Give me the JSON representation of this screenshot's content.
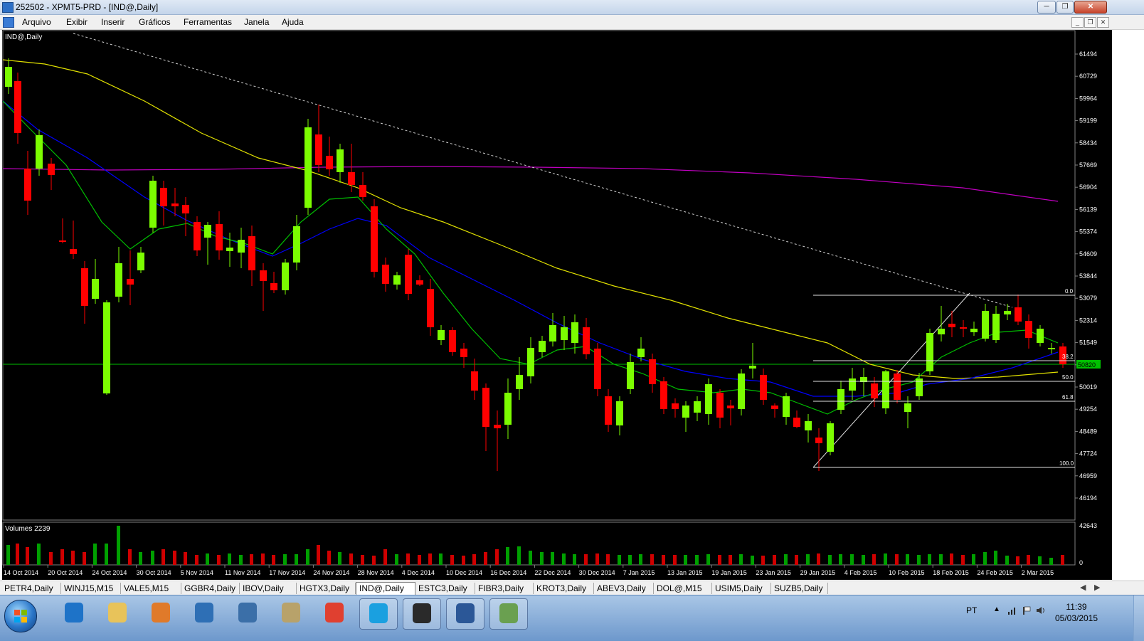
{
  "window": {
    "title": "252502 - XPMT5-PRD - [IND@,Daily]",
    "menu": [
      "Arquivo",
      "Exibir",
      "Inserir",
      "Gráficos",
      "Ferramentas",
      "Janela",
      "Ajuda"
    ]
  },
  "chart": {
    "symbol_label": "IND@,Daily",
    "price_axis": [
      "61494",
      "60729",
      "59964",
      "59199",
      "58434",
      "57669",
      "56904",
      "56139",
      "55374",
      "54609",
      "53844",
      "53079",
      "52314",
      "51549",
      "50784",
      "50019",
      "49254",
      "48489",
      "47724",
      "46959",
      "46194"
    ],
    "current_price": "50820",
    "fib_levels": [
      "0.0",
      "38.2",
      "50.0",
      "61.8",
      "100.0"
    ],
    "date_axis": [
      "14 Oct 2014",
      "20 Oct 2014",
      "24 Oct 2014",
      "30 Oct 2014",
      "5 Nov 2014",
      "11 Nov 2014",
      "17 Nov 2014",
      "24 Nov 2014",
      "28 Nov 2014",
      "4 Dec 2014",
      "10 Dec 2014",
      "16 Dec 2014",
      "22 Dec 2014",
      "30 Dec 2014",
      "7 Jan 2015",
      "13 Jan 2015",
      "19 Jan 2015",
      "23 Jan 2015",
      "29 Jan 2015",
      "4 Feb 2015",
      "10 Feb 2015",
      "18 Feb 2015",
      "24 Feb 2015",
      "2 Mar 2015"
    ],
    "volume_label": "Volumes 2239",
    "volume_axis": [
      "42643",
      "0"
    ],
    "colors": {
      "background": "#000000",
      "bull": "#7cfc00",
      "bear": "#ff0000",
      "ma_short": "#00c000",
      "ma_mid": "#0000ff",
      "ma_long": "#e0e000",
      "ma_200": "#c000c0"
    }
  },
  "tabs": [
    "PETR4,Daily",
    "WINJ15,M15",
    "VALE5,M15",
    "GGBR4,Daily",
    "IBOV,Daily",
    "HGTX3,Daily",
    "IND@,Daily",
    "ESTC3,Daily",
    "FIBR3,Daily",
    "KROT3,Daily",
    "ABEV3,Daily",
    "DOL@,M15",
    "USIM5,Daily",
    "SUZB5,Daily"
  ],
  "active_tab": "IND@,Daily",
  "taskbar": {
    "icons": [
      "windows-start-icon",
      "internet-explorer-icon",
      "folder-icon",
      "media-player-icon",
      "network-icon",
      "hp-icon",
      "archive-icon",
      "chrome-icon",
      "skype-icon",
      "xp-investimentos-icon",
      "word-icon",
      "metatrader-icon"
    ],
    "language": "PT",
    "time": "11:39",
    "date": "05/03/2015"
  }
}
